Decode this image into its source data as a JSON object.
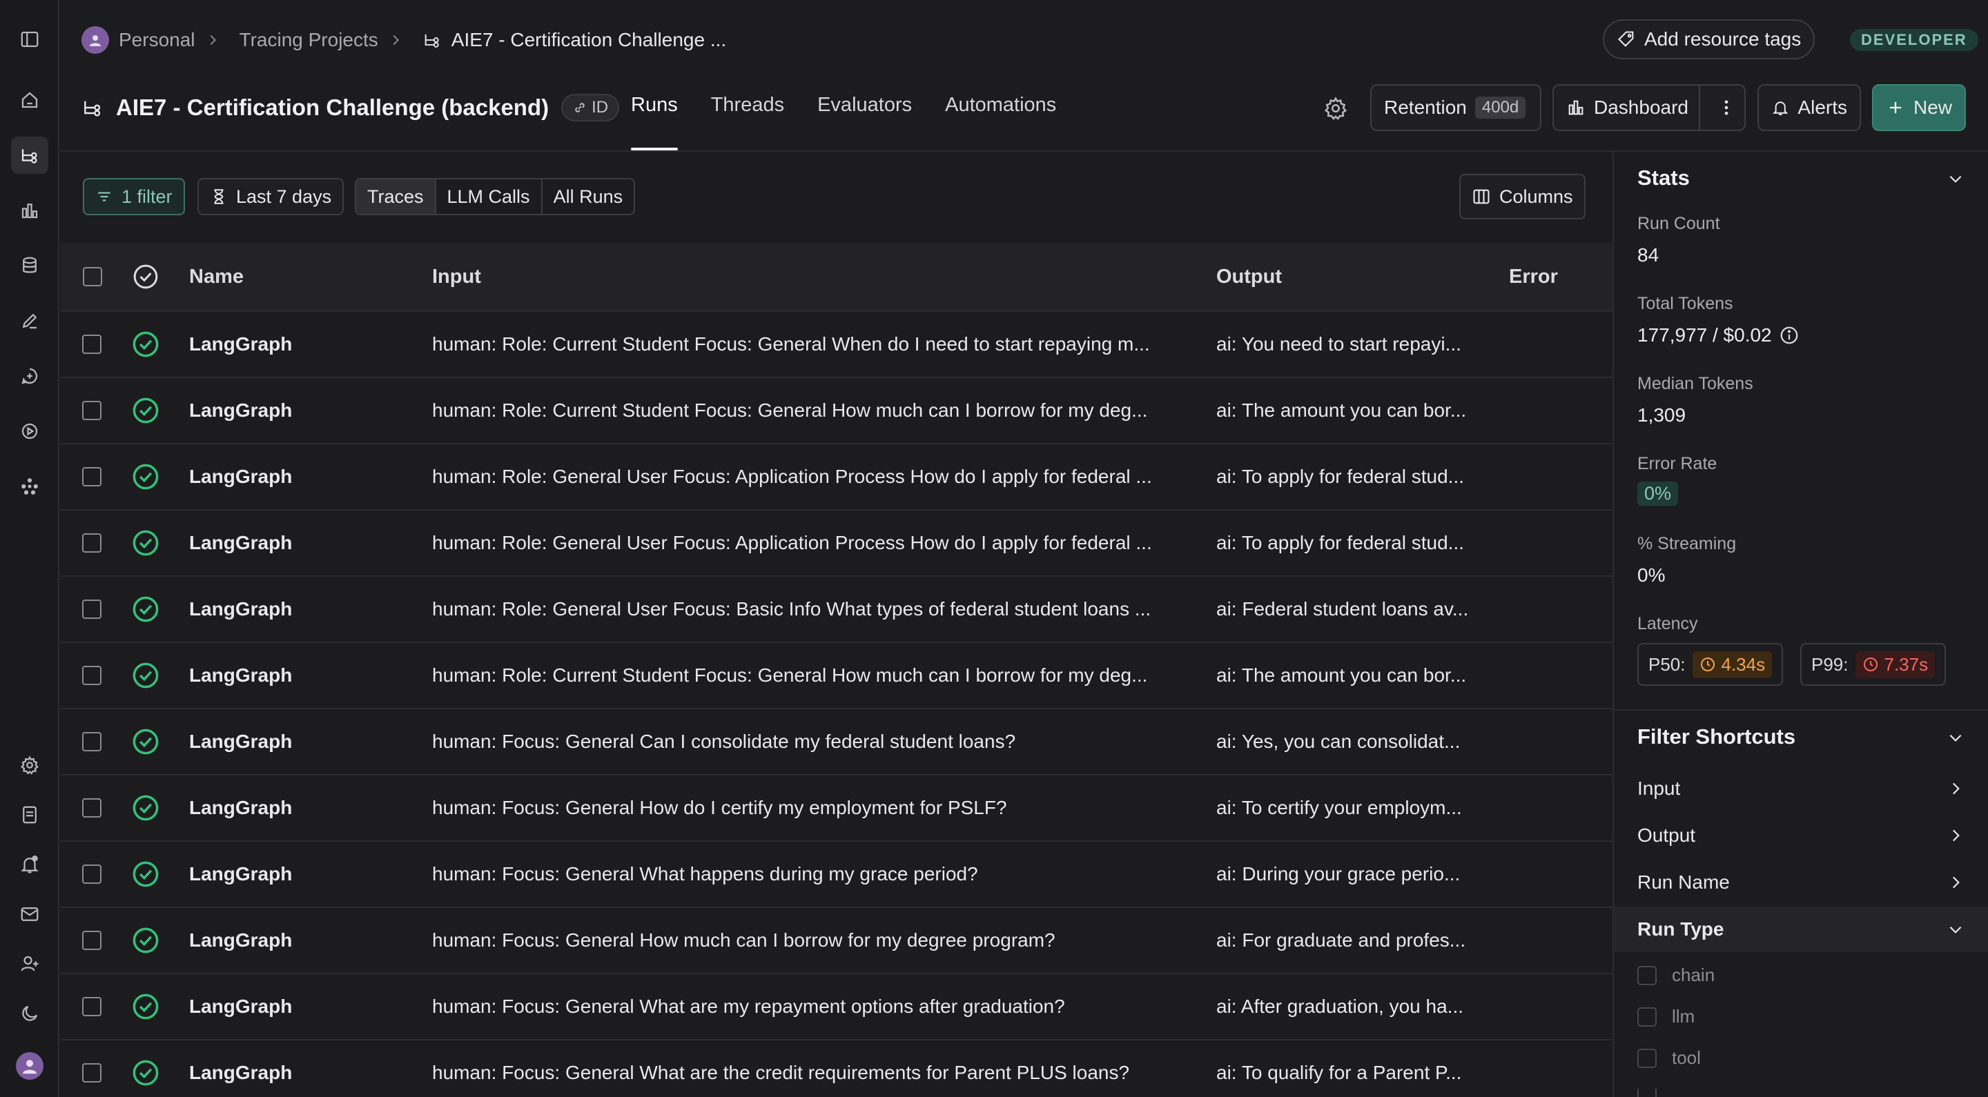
{
  "breadcrumb": {
    "items": [
      "Personal",
      "Tracing Projects",
      "AIE7 - Certification Challenge ..."
    ]
  },
  "header": {
    "add_tags_label": "Add resource tags",
    "role_badge": "DEVELOPER",
    "project_title": "AIE7 - Certification Challenge (backend)",
    "id_label": "ID",
    "tabs": [
      "Runs",
      "Threads",
      "Evaluators",
      "Automations"
    ],
    "active_tab": "Runs",
    "retention_label": "Retention",
    "retention_value": "400d",
    "dashboard_label": "Dashboard",
    "alerts_label": "Alerts",
    "new_label": "New"
  },
  "toolbar": {
    "filter_label": "1 filter",
    "time_label": "Last 7 days",
    "segments": [
      "Traces",
      "LLM Calls",
      "All Runs"
    ],
    "selected_segment": "Traces",
    "columns_label": "Columns"
  },
  "table": {
    "columns": [
      "Name",
      "Input",
      "Output",
      "Error"
    ],
    "rows": [
      {
        "name": "LangGraph",
        "input": "human: Role: Current Student Focus: General When do I need to start repaying m...",
        "output": "ai: You need to start repayi...",
        "error": ""
      },
      {
        "name": "LangGraph",
        "input": "human: Role: Current Student Focus: General How much can I borrow for my deg...",
        "output": "ai: The amount you can bor...",
        "error": ""
      },
      {
        "name": "LangGraph",
        "input": "human: Role: General User Focus: Application Process How do I apply for federal ...",
        "output": "ai: To apply for federal stud...",
        "error": ""
      },
      {
        "name": "LangGraph",
        "input": "human: Role: General User Focus: Application Process How do I apply for federal ...",
        "output": "ai: To apply for federal stud...",
        "error": ""
      },
      {
        "name": "LangGraph",
        "input": "human: Role: General User Focus: Basic Info What types of federal student loans ...",
        "output": "ai: Federal student loans av...",
        "error": ""
      },
      {
        "name": "LangGraph",
        "input": "human: Role: Current Student Focus: General How much can I borrow for my deg...",
        "output": "ai: The amount you can bor...",
        "error": ""
      },
      {
        "name": "LangGraph",
        "input": "human: Focus: General Can I consolidate my federal student loans?",
        "output": "ai: Yes, you can consolidat...",
        "error": ""
      },
      {
        "name": "LangGraph",
        "input": "human: Focus: General How do I certify my employment for PSLF?",
        "output": "ai: To certify your employm...",
        "error": ""
      },
      {
        "name": "LangGraph",
        "input": "human: Focus: General What happens during my grace period?",
        "output": "ai: During your grace perio...",
        "error": ""
      },
      {
        "name": "LangGraph",
        "input": "human: Focus: General How much can I borrow for my degree program?",
        "output": "ai: For graduate and profes...",
        "error": ""
      },
      {
        "name": "LangGraph",
        "input": "human: Focus: General What are my repayment options after graduation?",
        "output": "ai: After graduation, you ha...",
        "error": ""
      },
      {
        "name": "LangGraph",
        "input": "human: Focus: General What are the credit requirements for Parent PLUS loans?",
        "output": "ai: To qualify for a Parent P...",
        "error": ""
      }
    ]
  },
  "stats": {
    "title": "Stats",
    "run_count_label": "Run Count",
    "run_count": "84",
    "total_tokens_label": "Total Tokens",
    "total_tokens": "177,977 / $0.02",
    "median_tokens_label": "Median Tokens",
    "median_tokens": "1,309",
    "error_rate_label": "Error Rate",
    "error_rate": "0%",
    "streaming_label": "% Streaming",
    "streaming": "0%",
    "latency_label": "Latency",
    "p50_label": "P50:",
    "p50_value": "4.34s",
    "p99_label": "P99:",
    "p99_value": "7.37s"
  },
  "filter_shortcuts": {
    "title": "Filter Shortcuts",
    "items": [
      "Input",
      "Output",
      "Run Name",
      "Run Type"
    ],
    "run_type_options": [
      "chain",
      "llm",
      "tool"
    ]
  },
  "colors": {
    "accent": "#2d6f63",
    "success": "#34c17a",
    "p50": "#f3a451",
    "p99": "#ef6a5f"
  }
}
